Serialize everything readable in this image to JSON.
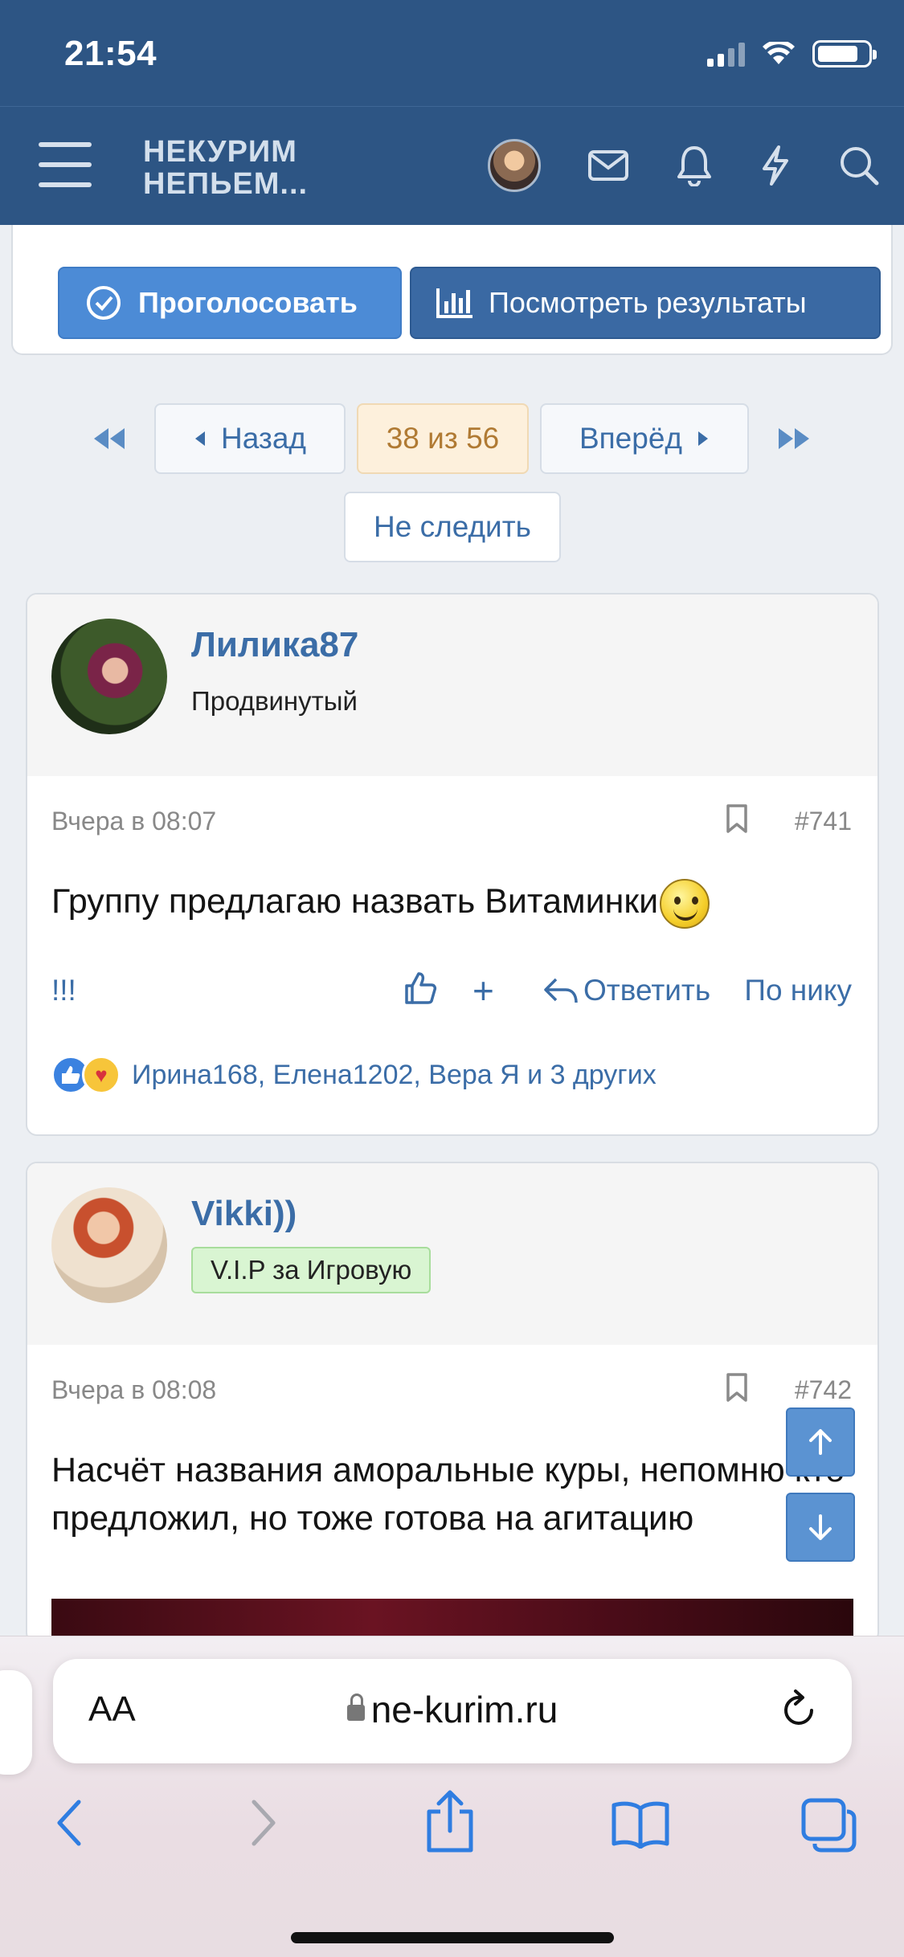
{
  "status": {
    "time": "21:54"
  },
  "header": {
    "logo_line1": "НЕКУРИМ",
    "logo_line2": "НЕПЬЕМ..."
  },
  "poll": {
    "vote_label": "Проголосовать",
    "results_label": "Посмотреть результаты"
  },
  "pagination": {
    "prev_label": "Назад",
    "current_label": "38 из 56",
    "next_label": "Вперёд",
    "unfollow_label": "Не следить"
  },
  "posts": [
    {
      "username": "Лилика87",
      "user_title": "Продвинутый",
      "date": "Вчера в 08:07",
      "number": "#741",
      "text": "Группу предлагаю назвать Витаминки",
      "excl": "!!!",
      "reply_label": "Ответить",
      "by_nick_label": "По нику",
      "reactions_text": "Ирина168, Елена1202, Вера Я и 3 других"
    },
    {
      "username": "Vikki))",
      "user_badge": "V.I.P за Игровую",
      "date": "Вчера в 08:08",
      "number": "#742",
      "text": "Насчёт названия аморальные куры, непомню кто предложил, но тоже готова на агитацию"
    }
  ],
  "safari": {
    "text_size_label": "AA",
    "url": "ne-kurim.ru"
  },
  "colors": {
    "header": "#2d5584",
    "link": "#3b6da7",
    "accent": "#4c8bd6",
    "current_page_bg": "#fdf0dc"
  }
}
